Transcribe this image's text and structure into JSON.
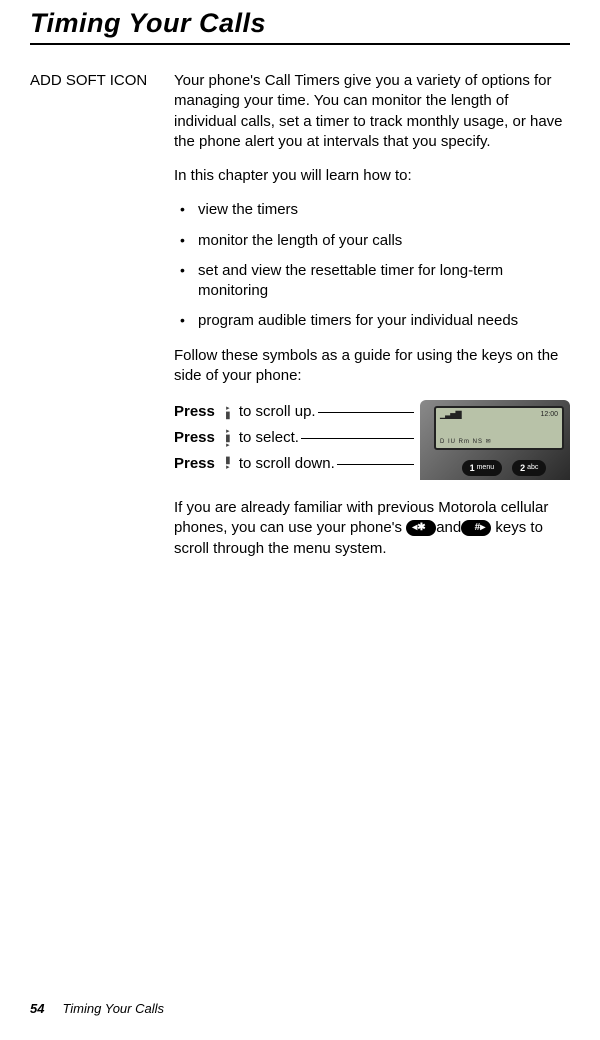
{
  "title": "Timing Your Calls",
  "margin_note": "ADD SOFT ICON",
  "intro": "Your phone's Call Timers give you a variety of options for managing your time. You can monitor the length of individual calls, set a timer to track monthly usage, or have the phone alert you at intervals that you specify.",
  "learn_lead": "In this chapter you will learn how to:",
  "bullets": [
    "view the timers",
    "monitor the length of your calls",
    "set and view the resettable timer for long-term monitoring",
    "program audible timers for your individual needs"
  ],
  "follow_symbols": "Follow these symbols as a guide for using the keys on the side of your phone:",
  "press": {
    "label": "Press",
    "up": "to scroll up.",
    "select": "to select.",
    "down": "to scroll down."
  },
  "phone": {
    "time": "12:00",
    "status": "D  IU  Rm      NS",
    "key1": {
      "num": "1",
      "sub": "menu"
    },
    "key2": {
      "num": "2",
      "sub": "abc"
    }
  },
  "familiar_1": "If you are already familiar with previous Motorola cellular phones, you can use your phone's",
  "familiar_and": "and",
  "familiar_2": " keys to scroll through the menu system.",
  "key_star": "✱",
  "key_hash": "#",
  "footer": {
    "page": "54",
    "title": "Timing Your Calls"
  }
}
